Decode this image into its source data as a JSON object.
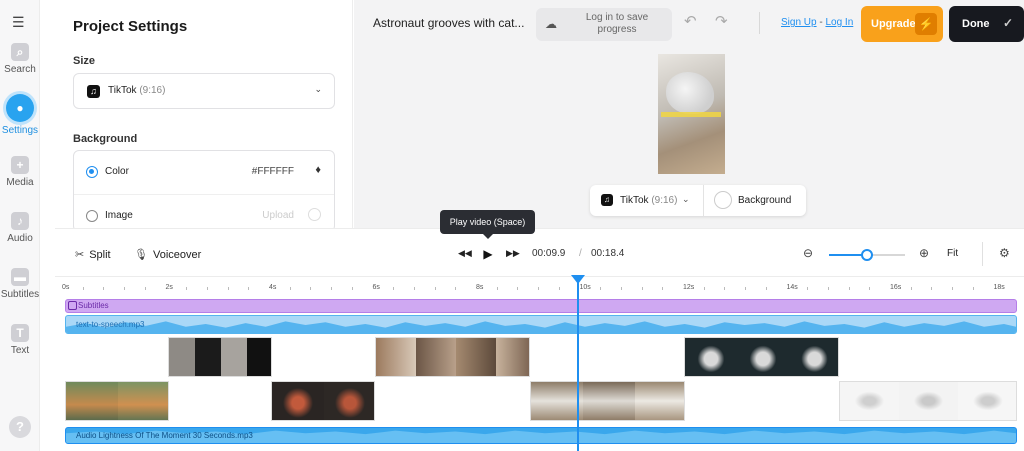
{
  "rail": {
    "items": [
      {
        "label": "Search",
        "icon": "search-icon"
      },
      {
        "label": "Settings",
        "icon": "settings-icon"
      },
      {
        "label": "Media",
        "icon": "plus-icon"
      },
      {
        "label": "Audio",
        "icon": "music-note-icon"
      },
      {
        "label": "Subtitles",
        "icon": "subtitles-icon"
      },
      {
        "label": "Text",
        "icon": "text-icon"
      }
    ],
    "help": "?"
  },
  "panel": {
    "title": "Project Settings",
    "size_label": "Size",
    "size_value": "TikTok",
    "size_ratio": "(9:16)",
    "background_label": "Background",
    "color_label": "Color",
    "color_value": "#FFFFFF",
    "image_label": "Image",
    "upload_label": "Upload"
  },
  "header": {
    "project_title": "Astronaut grooves with cat...",
    "save_text": "Log in to save progress",
    "sign_up": "Sign Up",
    "separator": " - ",
    "log_in": "Log In",
    "upgrade": "Upgrade",
    "done": "Done"
  },
  "preview_bar": {
    "size_value": "TikTok",
    "size_ratio": "(9:16)",
    "background": "Background"
  },
  "toolbar": {
    "split": "Split",
    "voiceover": "Voiceover",
    "tooltip": "Play video (Space)",
    "current_time": "00:09.9",
    "time_sep": "/",
    "total_time": "00:18.4",
    "fit": "Fit",
    "zoom_level": 0.5
  },
  "timeline": {
    "ticks": [
      "0s",
      "2s",
      "4s",
      "6s",
      "8s",
      "10s",
      "12s",
      "14s",
      "16s",
      "18s"
    ],
    "subtitle_track": "Subtitles",
    "voice_track": "text-to-speech.mp3",
    "music_track": "Audio Lightness Of The Moment 30 Seconds.mp3",
    "playhead_seconds": 9.9
  },
  "colors": {
    "accent": "#1f8ff0",
    "upgrade": "#f9a11b",
    "done": "#17191f",
    "subtitle_track": "#cfa8f2",
    "audio_track": "#aad8f7",
    "music_track": "#3aa7ec"
  }
}
